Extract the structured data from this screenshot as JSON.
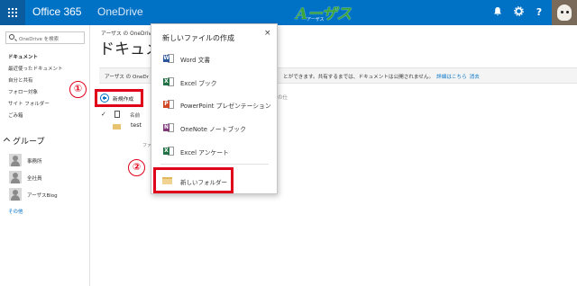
{
  "topbar": {
    "brand": "Office 365",
    "app_name": "OneDrive",
    "logo_main": "Aーザス",
    "logo_sub": "アーザス",
    "bell_icon": "bell-icon",
    "settings_icon": "gear-icon",
    "help_icon": "help-icon",
    "accent": "#0072c6"
  },
  "sidebar": {
    "search_placeholder": "OneDrive を検索",
    "section_title": "ドキュメント",
    "items": [
      {
        "label": "最近使ったドキュメント"
      },
      {
        "label": "自分と共有"
      },
      {
        "label": "フォロー対象"
      },
      {
        "label": "サイト フォルダー"
      },
      {
        "label": "ごみ箱"
      }
    ],
    "groups_header": "グループ",
    "groups": [
      {
        "label": "事務所"
      },
      {
        "label": "全社員"
      },
      {
        "label": "アーザスBlog"
      }
    ],
    "more_link": "その他"
  },
  "main": {
    "breadcrumb": "アーザス の OneDrive",
    "title": "ドキュメン",
    "info_left": "アーザス の OneDr",
    "info_right": "とができます。共有するまでは、ドキュメントは公開されません。",
    "info_link_details": "詳細はこちら",
    "info_link_dismiss": "消去",
    "new_button_label": "新規作成",
    "column_name": "名前",
    "rows": [
      {
        "name": "test"
      }
    ],
    "truncated_text": "ファ",
    "modified_partial": "の仕"
  },
  "annotations": {
    "marker1": "①",
    "marker2": "②",
    "highlight_color": "#e0001a"
  },
  "new_menu": {
    "title": "新しいファイルの作成",
    "close_glyph": "×",
    "items": [
      {
        "label": "Word 文書",
        "letter": "W",
        "color": "#2b579a"
      },
      {
        "label": "Excel ブック",
        "letter": "X",
        "color": "#217346"
      },
      {
        "label": "PowerPoint プレゼンテーション",
        "letter": "P",
        "color": "#d24726"
      },
      {
        "label": "OneNote ノートブック",
        "letter": "N",
        "color": "#80397b"
      },
      {
        "label": "Excel アンケート",
        "letter": "X",
        "color": "#217346"
      }
    ],
    "folder_label": "新しいフォルダー"
  }
}
